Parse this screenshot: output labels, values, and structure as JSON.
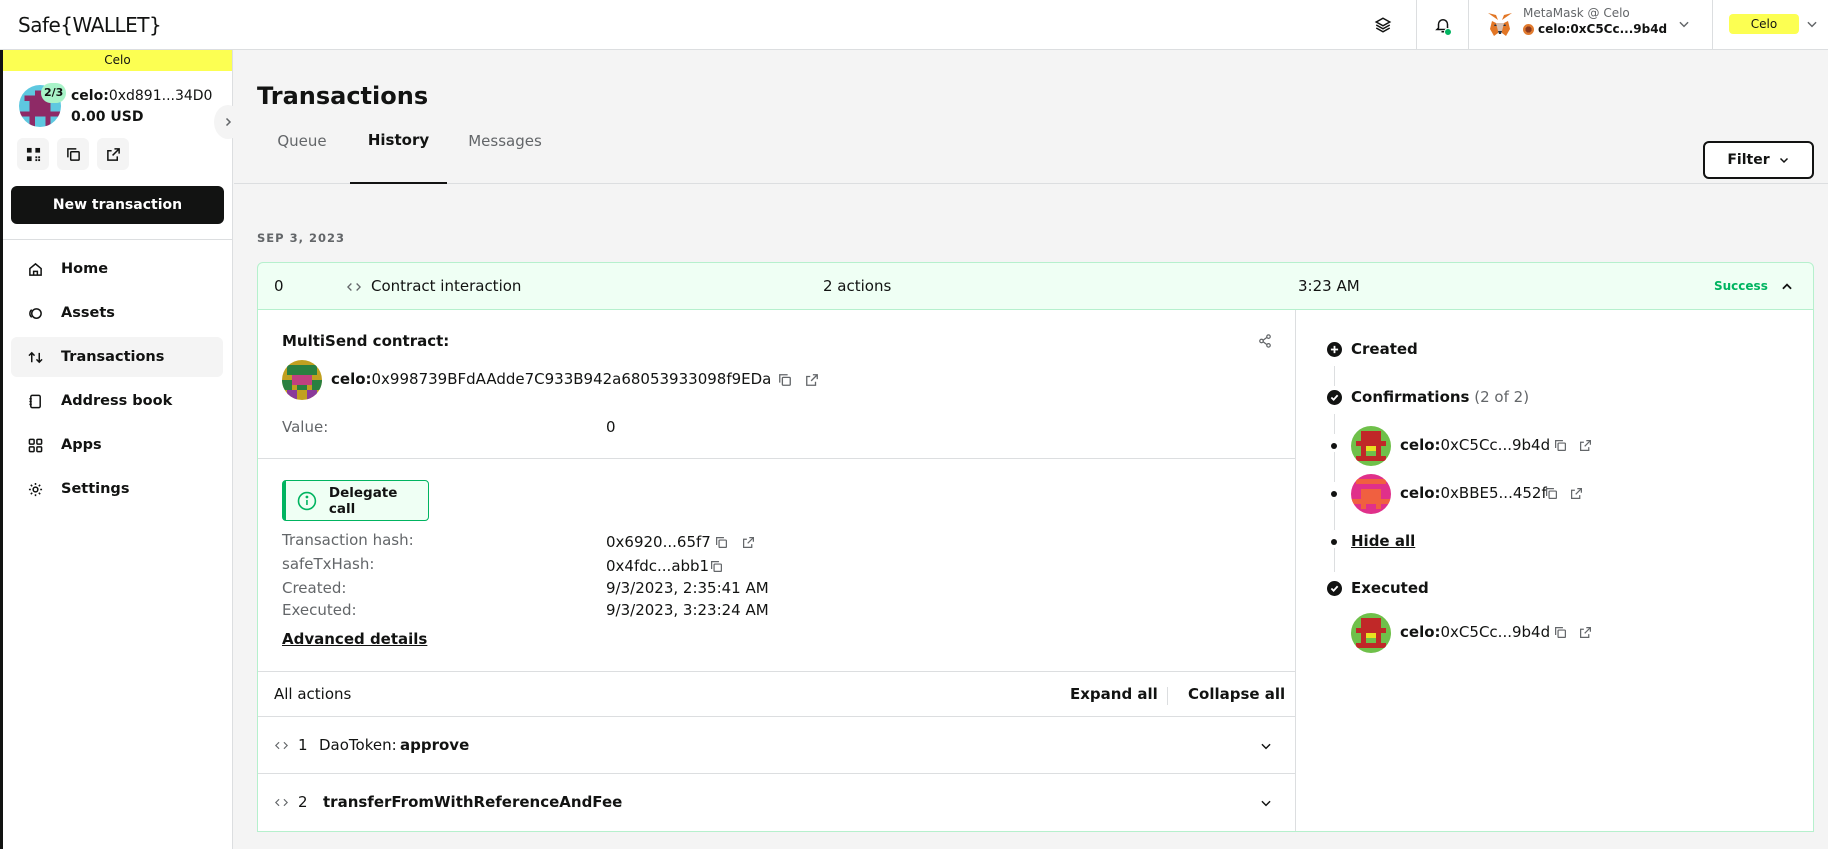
{
  "topbar": {
    "logo": "Safe{WALLET}",
    "wallet_name": "MetaMask @ Celo",
    "wallet_prefix": "celo:",
    "wallet_address": "0xC5Cc...9b4d",
    "network": "Celo"
  },
  "sidebar": {
    "chain_name": "Celo",
    "threshold": "2/3",
    "safe_prefix": "celo:",
    "safe_address": "0xd891...34D0",
    "balance": "0.00 USD",
    "new_tx_label": "New transaction",
    "items": [
      {
        "label": "Home",
        "icon": "home-icon"
      },
      {
        "label": "Assets",
        "icon": "assets-icon"
      },
      {
        "label": "Transactions",
        "icon": "transactions-icon"
      },
      {
        "label": "Address book",
        "icon": "address-book-icon"
      },
      {
        "label": "Apps",
        "icon": "apps-icon"
      },
      {
        "label": "Settings",
        "icon": "settings-icon"
      }
    ],
    "active_item": "Transactions"
  },
  "main": {
    "title": "Transactions",
    "tabs": [
      {
        "label": "Queue"
      },
      {
        "label": "History"
      },
      {
        "label": "Messages"
      }
    ],
    "active_tab": "History",
    "filter_label": "Filter",
    "date_header": "SEP 3, 2023"
  },
  "tx": {
    "nonce": "0",
    "type": "Contract interaction",
    "actions_count": "2 actions",
    "time": "3:23 AM",
    "status": "Success",
    "multisend_label": "MultiSend contract:",
    "contract_prefix": "celo:",
    "contract_address": "0x998739BFdAAdde7C933B942a68053933098f9EDa",
    "value_label": "Value:",
    "value": "0",
    "delegate_call_label": "Delegate call",
    "tx_hash_label": "Transaction hash:",
    "tx_hash": "0x6920...65f7",
    "safe_tx_hash_label": "safeTxHash:",
    "safe_tx_hash": "0x4fdc...abb1",
    "created_label": "Created:",
    "created": "9/3/2023, 2:35:41 AM",
    "executed_label": "Executed:",
    "executed": "9/3/2023, 3:23:24 AM",
    "advanced_label": "Advanced details",
    "all_actions_label": "All actions",
    "expand_all": "Expand all",
    "collapse_all": "Collapse all",
    "actions": [
      {
        "index": "1",
        "contract": "DaoToken:",
        "method": "approve"
      },
      {
        "index": "2",
        "contract": "",
        "method": "transferFromWithReferenceAndFee"
      }
    ]
  },
  "timeline": {
    "created_label": "Created",
    "confirmations_label": "Confirmations",
    "confirmations_count": "(2 of 2)",
    "signers": [
      {
        "prefix": "celo:",
        "address": "0xC5Cc...9b4d"
      },
      {
        "prefix": "celo:",
        "address": "0xBBE5...452f"
      }
    ],
    "hide_all_label": "Hide all",
    "executed_label": "Executed",
    "executor": {
      "prefix": "celo:",
      "address": "0xC5Cc...9b4d"
    }
  },
  "colors": {
    "success": "#00b460",
    "success_bg": "#effff4",
    "chain_yellow": "#fcff52",
    "text": "#121312",
    "muted": "#636669",
    "border": "#dcdee0"
  }
}
